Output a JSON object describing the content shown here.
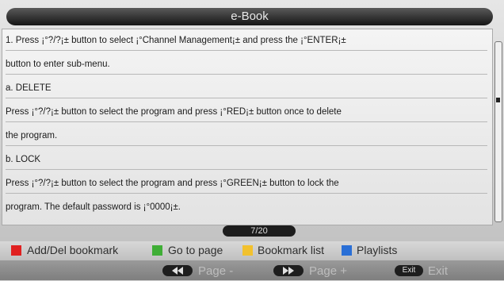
{
  "window": {
    "title": "e-Book"
  },
  "content": {
    "lines": [
      "1.   Press ¡°?/?¡± button to select ¡°Channel Management¡± and press the ¡°ENTER¡±",
      "button to enter sub-menu.",
      "a. DELETE",
      "        Press ¡°?/?¡± button to select the program and press ¡°RED¡± button once to delete",
      " the program.",
      "b. LOCK",
      "Press ¡°?/?¡± button to select the program and press ¡°GREEN¡± button to lock the",
      "program. The default password is ¡°0000¡±."
    ]
  },
  "page_indicator": "7/20",
  "legend": {
    "red_label": "Add/Del bookmark",
    "green_label": "Go to page",
    "yellow_label": "Bookmark list",
    "blue_label": "Playlists",
    "colors": {
      "red": "#e02020",
      "green": "#3fae36",
      "yellow": "#f2c12e",
      "blue": "#2a6fd6"
    }
  },
  "nav": {
    "prev_label": "Page -",
    "next_label": "Page +",
    "exit_label": "Exit",
    "exit_key": "Exit",
    "prev_icon": "rewind-icon",
    "next_icon": "fast-forward-icon"
  }
}
